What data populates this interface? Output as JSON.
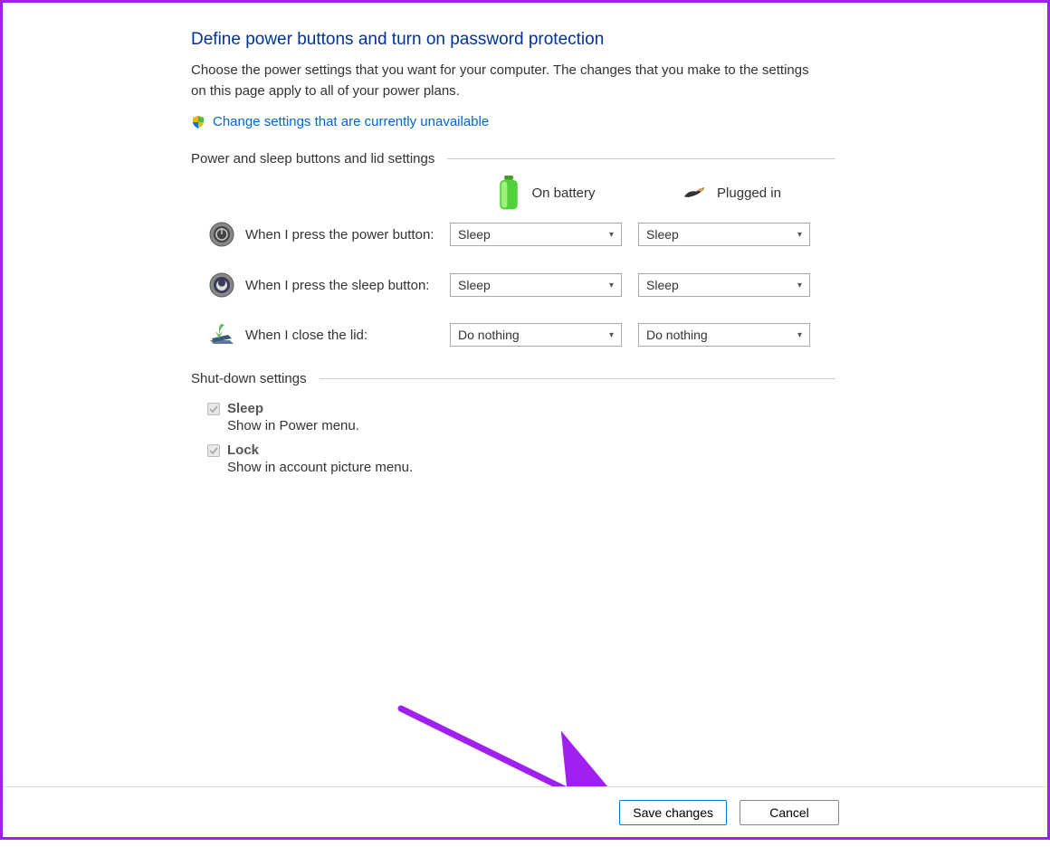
{
  "page": {
    "title": "Define power buttons and turn on password protection",
    "description": "Choose the power settings that you want for your computer. The changes that you make to the settings on this page apply to all of your power plans.",
    "admin_link": "Change settings that are currently unavailable"
  },
  "section1": {
    "title": "Power and sleep buttons and lid settings",
    "col_battery": "On battery",
    "col_plugged": "Plugged in",
    "rows": {
      "power": {
        "label": "When I press the power button:",
        "battery": "Sleep",
        "plugged": "Sleep"
      },
      "sleep": {
        "label": "When I press the sleep button:",
        "battery": "Sleep",
        "plugged": "Sleep"
      },
      "lid": {
        "label": "When I close the lid:",
        "battery": "Do nothing",
        "plugged": "Do nothing"
      }
    }
  },
  "section2": {
    "title": "Shut-down settings",
    "items": {
      "sleep": {
        "title": "Sleep",
        "desc": "Show in Power menu."
      },
      "lock": {
        "title": "Lock",
        "desc": "Show in account picture menu."
      }
    }
  },
  "footer": {
    "save": "Save changes",
    "cancel": "Cancel"
  }
}
